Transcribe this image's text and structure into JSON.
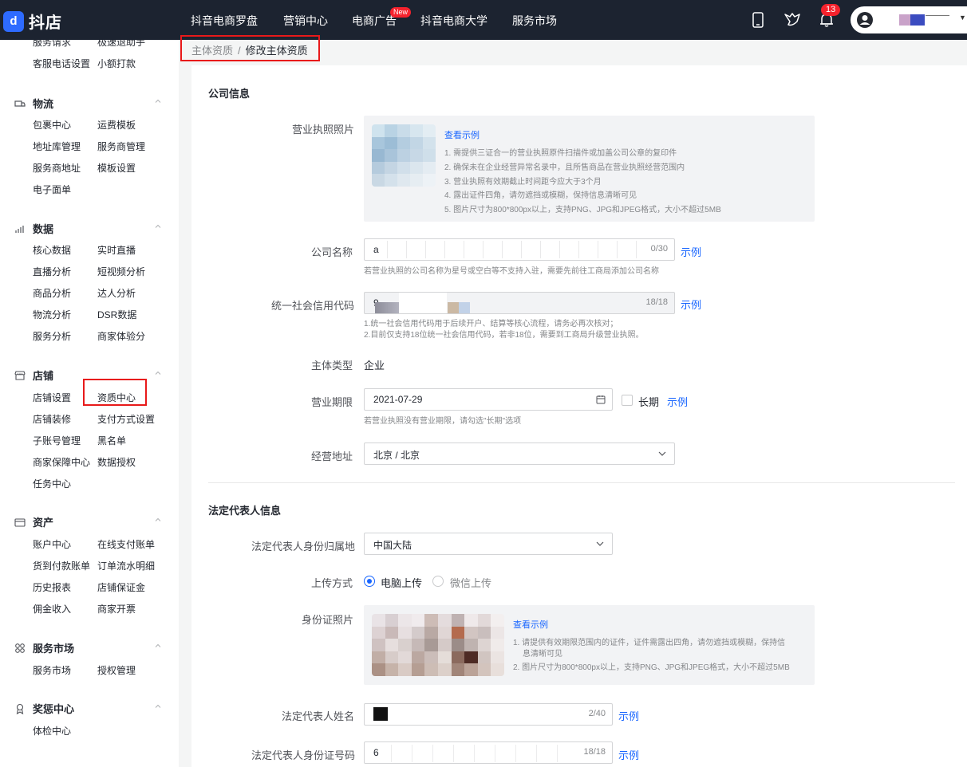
{
  "app": {
    "logo_text": "抖店",
    "logo_mark": "d"
  },
  "topnav": {
    "items": [
      "抖音电商罗盘",
      "营销中心",
      "电商广告",
      "抖音电商大学",
      "服务市场"
    ],
    "ad_badge": "New",
    "bell_count": "13"
  },
  "sidebar": {
    "top_links": [
      "服务请求",
      "极速退助手",
      "客服电话设置",
      "小额打款"
    ],
    "groups": [
      {
        "title": "物流",
        "icon": "truck-icon",
        "links": [
          "包裹中心",
          "运费模板",
          "地址库管理",
          "服务商管理",
          "服务商地址",
          "模板设置",
          "电子面单"
        ]
      },
      {
        "title": "数据",
        "icon": "chart-icon",
        "links": [
          "核心数据",
          "实时直播",
          "直播分析",
          "短视频分析",
          "商品分析",
          "达人分析",
          "物流分析",
          "DSR数据",
          "服务分析",
          "商家体验分"
        ]
      },
      {
        "title": "店铺",
        "icon": "shop-icon",
        "links": [
          "店铺设置",
          "资质中心",
          "店铺装修",
          "支付方式设置",
          "子账号管理",
          "黑名单",
          "商家保障中心",
          "数据授权",
          "任务中心"
        ]
      },
      {
        "title": "资产",
        "icon": "wallet-icon",
        "links": [
          "账户中心",
          "在线支付账单",
          "货到付款账单",
          "订单流水明细",
          "历史报表",
          "店铺保证金",
          "佣金收入",
          "商家开票"
        ]
      },
      {
        "title": "服务市场",
        "icon": "grid-icon",
        "links": [
          "服务市场",
          "授权管理"
        ]
      },
      {
        "title": "奖惩中心",
        "icon": "award-icon",
        "links": [
          "体检中心"
        ]
      }
    ]
  },
  "breadcrumb": {
    "parent": "主体资质",
    "separator": "/",
    "current": "修改主体资质"
  },
  "company": {
    "section_title": "公司信息",
    "license_label": "营业执照照片",
    "license_example_link": "查看示例",
    "license_hints": [
      "1. 需提供三证合一的营业执照原件扫描件或加盖公司公章的复印件",
      "2. 确保未在企业经营异常名录中，且所售商品在营业执照经营范围内",
      "3. 营业执照有效期截止时间距今应大于3个月",
      "4. 露出证件四角，请勿遮挡或模糊，保持信息清晰可见",
      "5. 图片尺寸为800*800px以上，支持PNG、JPG和JPEG格式，大小不超过5MB"
    ],
    "name_label": "公司名称",
    "name_value": "a",
    "name_count": "0/30",
    "name_example": "示例",
    "name_hint": "若营业执照的公司名称为星号或空白等不支持入驻，需要先前往工商局添加公司名称",
    "credit_label": "统一社会信用代码",
    "credit_value": "9",
    "credit_count": "18/18",
    "credit_example": "示例",
    "credit_hints": [
      "1.统一社会信用代码用于后续开户、结算等核心流程，请务必再次核对；",
      "2.目前仅支持18位统一社会信用代码，若非18位，需要到工商局升级营业执照。"
    ],
    "type_label": "主体类型",
    "type_value": "企业",
    "period_label": "营业期限",
    "period_value": "2021-07-29",
    "period_long_label": "长期",
    "period_example": "示例",
    "period_hint": "若营业执照没有营业期限，请勾选\"长期\"选项",
    "address_label": "经营地址",
    "address_value": "北京 / 北京"
  },
  "legal": {
    "section_title": "法定代表人信息",
    "region_label": "法定代表人身份归属地",
    "region_value": "中国大陆",
    "upload_label": "上传方式",
    "upload_options": [
      "电脑上传",
      "微信上传"
    ],
    "upload_selected": "电脑上传",
    "id_photo_label": "身份证照片",
    "id_example_link": "查看示例",
    "id_hints": [
      "1. 请提供有效期限范围内的证件，证件需露出四角，请勿遮挡或模糊，保持信",
      "息清晰可见",
      "2. 图片尺寸为800*800px以上，支持PNG、JPG和JPEG格式，大小不超过5MB"
    ],
    "name_label": "法定代表人姓名",
    "name_count": "2/40",
    "name_example": "示例",
    "idno_label": "法定代表人身份证号码",
    "idno_value": "6",
    "idno_count": "18/18",
    "idno_example": "示例"
  },
  "colors": {
    "accent": "#1966ff",
    "highlight": "#e8191a",
    "topbar": "#1c2330"
  }
}
